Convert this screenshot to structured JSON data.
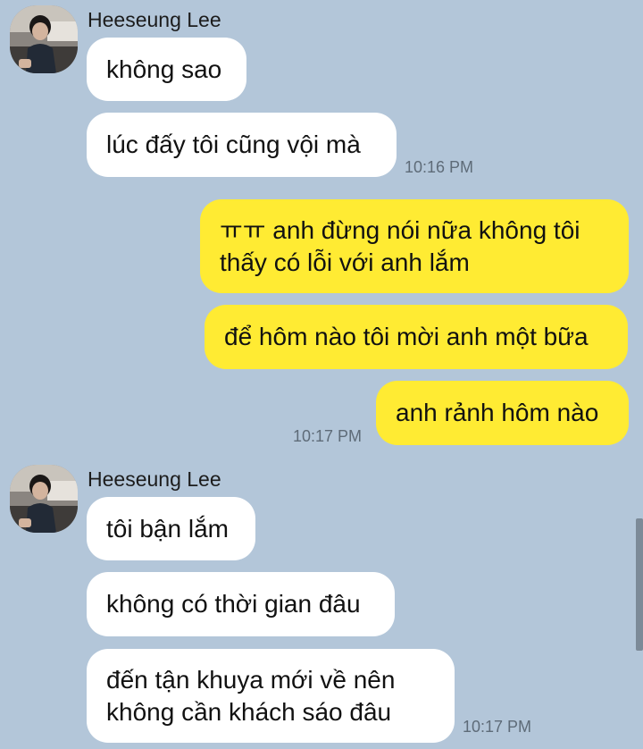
{
  "colors": {
    "background": "#b3c6d9",
    "incoming_bubble": "#ffffff",
    "outgoing_bubble": "#ffeb33",
    "timestamp_text": "#5e6b78",
    "scrollbar": "#7c8a98"
  },
  "groups": [
    {
      "sender": "Heeseung Lee",
      "avatar_icon": "profile-photo",
      "messages": [
        {
          "text": "không sao"
        },
        {
          "text": "lúc đấy tôi cũng vội mà",
          "time": "10:16 PM"
        }
      ]
    },
    {
      "outgoing": true,
      "messages": [
        {
          "text": "ㅠㅠ anh đừng nói nữa không tôi thấy có lỗi với anh lắm"
        },
        {
          "text": "để hôm nào tôi mời anh một bữa"
        },
        {
          "text": "anh rảnh hôm nào",
          "time": "10:17 PM"
        }
      ]
    },
    {
      "sender": "Heeseung Lee",
      "avatar_icon": "profile-photo",
      "messages": [
        {
          "text": "tôi bận lắm"
        },
        {
          "text": "không có thời gian đâu"
        },
        {
          "text": "đến tận khuya mới về nên không cần khách sáo đâu",
          "time": "10:17 PM"
        }
      ]
    }
  ]
}
